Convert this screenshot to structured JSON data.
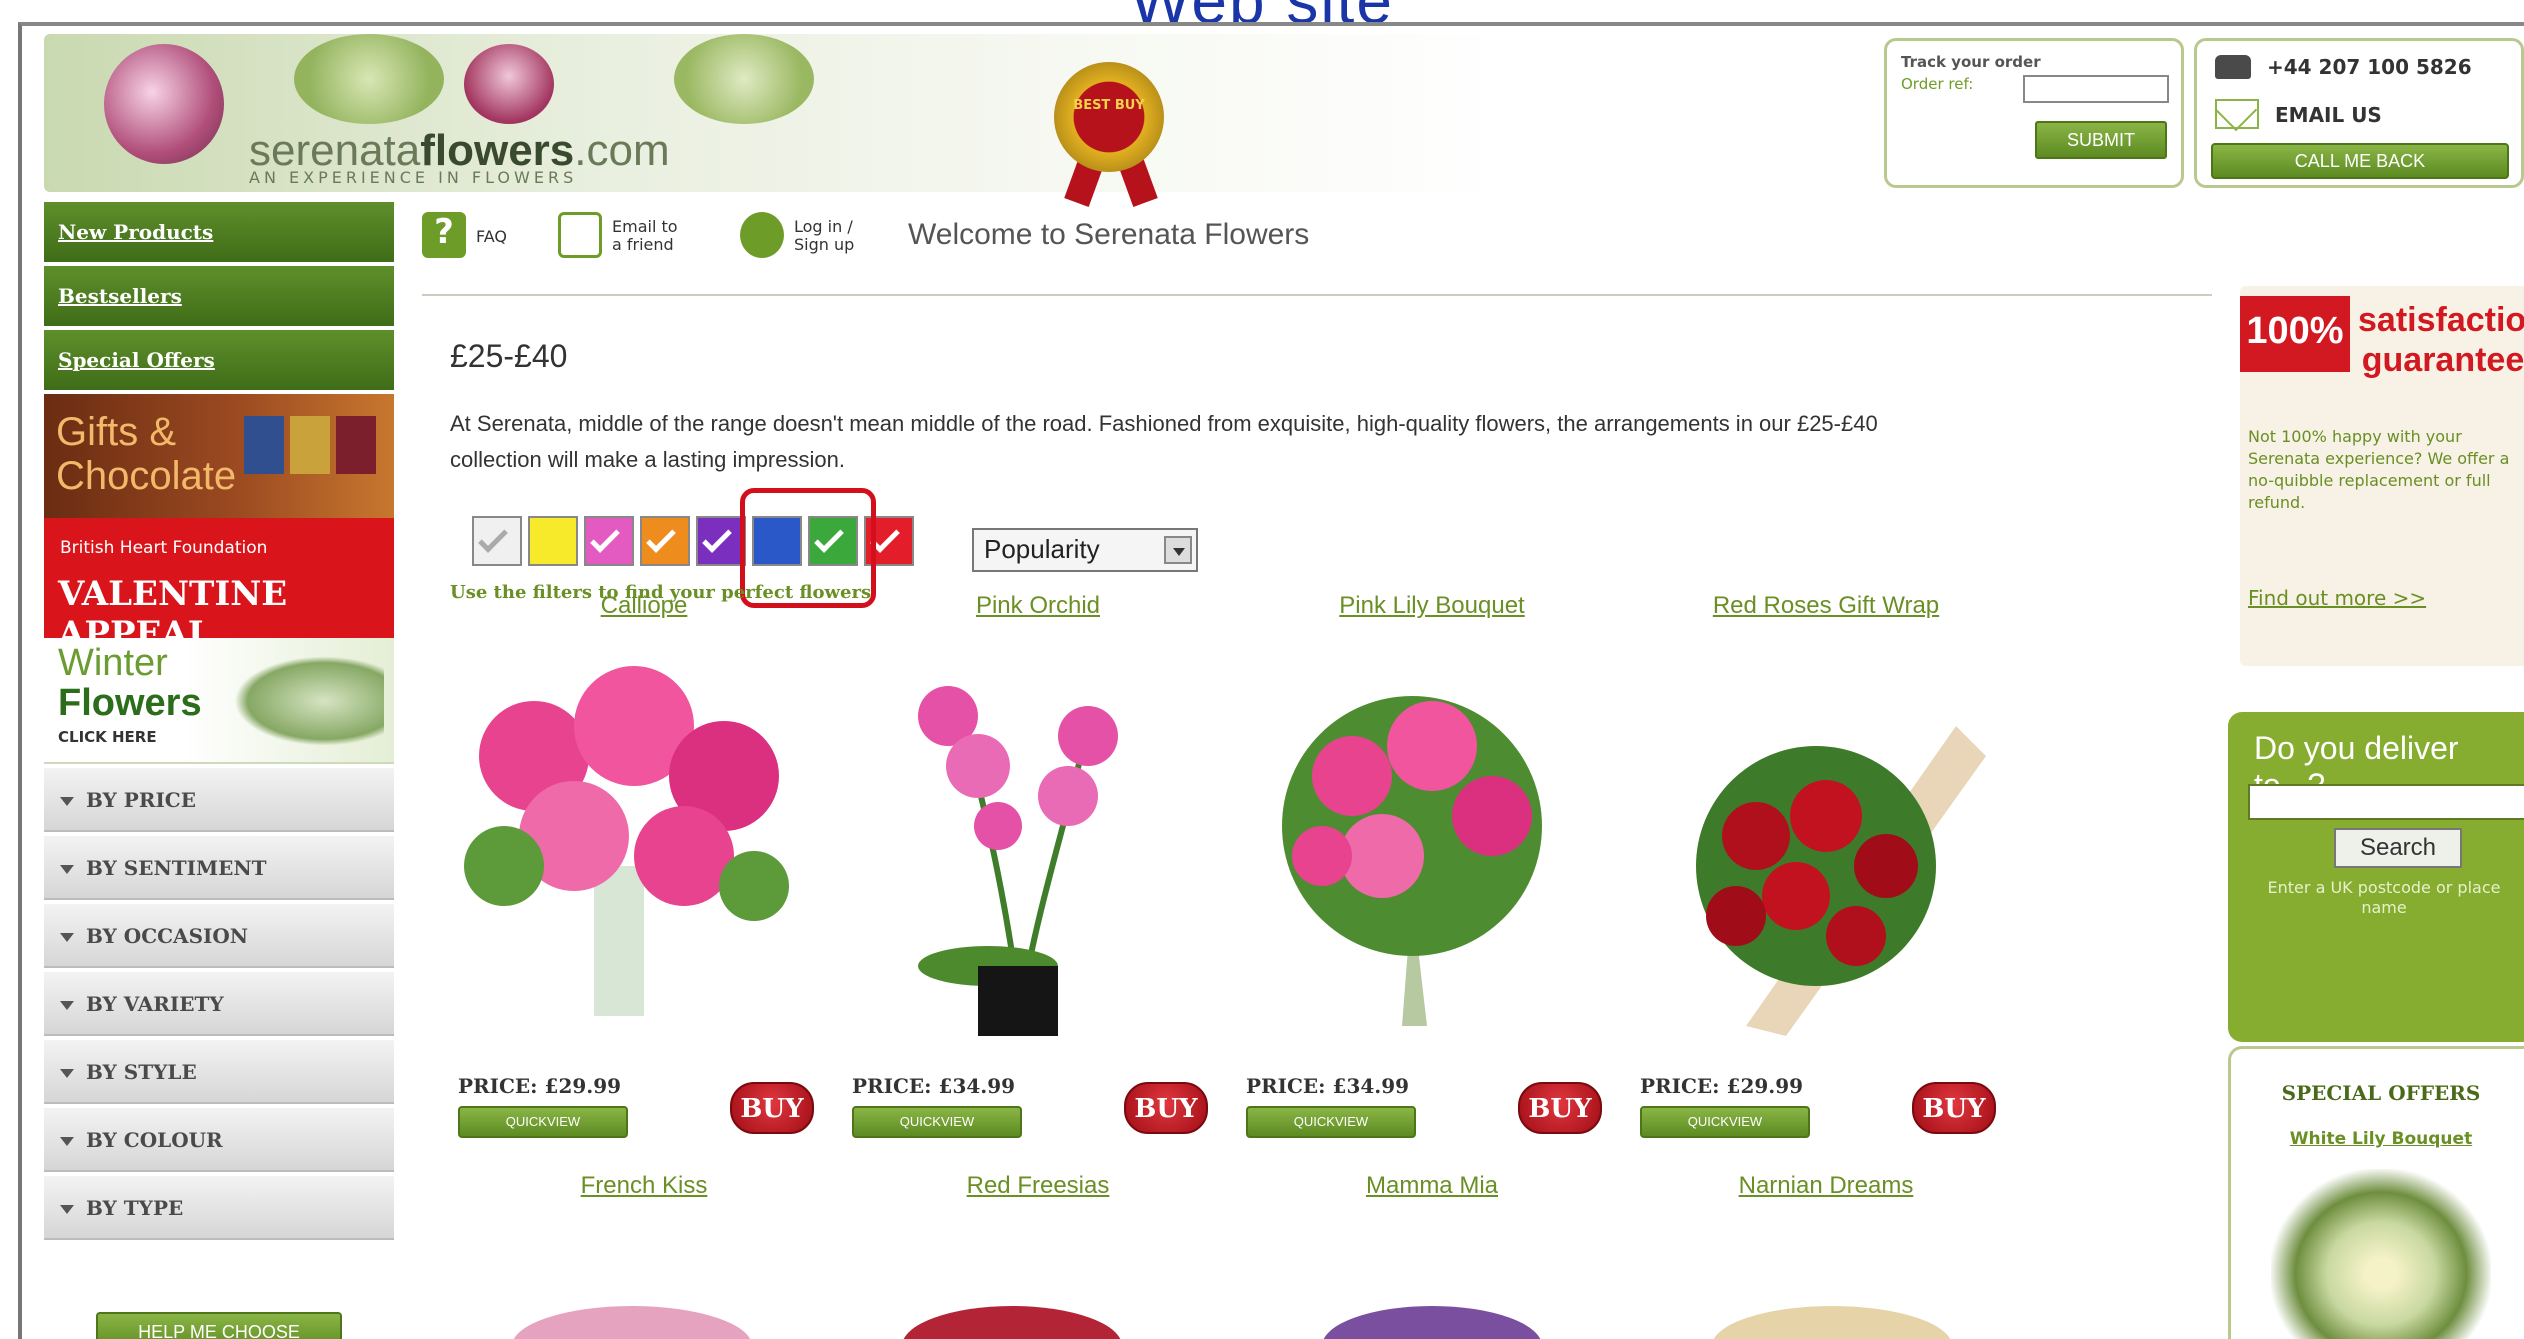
{
  "caption": "Web site",
  "header": {
    "logo_main": "serenata",
    "logo_bold": "flowers",
    "logo_tld": ".com",
    "logo_tagline": "AN EXPERIENCE IN FLOWERS",
    "award_text": "BEST BUY",
    "track_title": "Track your order",
    "order_ref_label": "Order ref:",
    "order_ref_value": "",
    "submit_label": "SUBMIT",
    "phone": "+44 207 100 5826",
    "email_label": "EMAIL US",
    "call_back_label": "CALL ME BACK"
  },
  "sidebar": {
    "nav": [
      "New Products",
      "Bestsellers",
      "Special Offers"
    ],
    "gifts_promo": "Gifts & Chocolate",
    "bhf_promo_top": "British Heart Foundation",
    "bhf_promo_main": "VALENTINE APPEAL",
    "winter_line1": "Winter",
    "winter_line2": "Flowers",
    "winter_cta": "CLICK HERE",
    "categories": [
      "BY PRICE",
      "BY SENTIMENT",
      "BY OCCASION",
      "BY VARIETY",
      "BY STYLE",
      "BY COLOUR",
      "BY TYPE"
    ],
    "help_label": "HELP ME CHOOSE"
  },
  "toolbar": {
    "faq": "FAQ",
    "email_friend_1": "Email to",
    "email_friend_2": "a friend",
    "login_1": "Log in /",
    "login_2": "Sign up",
    "welcome": "Welcome to Serenata Flowers"
  },
  "main": {
    "title": "£25-£40",
    "intro": "At Serenata, middle of the range doesn't mean middle of the road. Fashioned from exquisite, high-quality flowers, the arrangements in our £25-£40 collection will make a lasting impression.",
    "sort_selected": "Popularity",
    "filter_hint": "Use the filters to find your perfect flowers",
    "swatch_colors": [
      "#f0f0f0",
      "#f6ea2a",
      "#e35ac0",
      "#ef8c1e",
      "#7b2fbf",
      "#2a58c9",
      "#3aa83a",
      "#e41d2a"
    ],
    "products_row1": [
      {
        "name": "Calliope",
        "price": "PRICE: £29.99"
      },
      {
        "name": "Pink Orchid",
        "price": "PRICE: £34.99"
      },
      {
        "name": "Pink Lily Bouquet",
        "price": "PRICE: £34.99"
      },
      {
        "name": "Red Roses Gift Wrap",
        "price": "PRICE: £29.99"
      }
    ],
    "products_row2": [
      {
        "name": "French Kiss"
      },
      {
        "name": "Red Freesias"
      },
      {
        "name": "Mamma Mia"
      },
      {
        "name": "Narnian Dreams"
      }
    ],
    "quickview_label": "QUICKVIEW",
    "buy_label": "BUY"
  },
  "right": {
    "guarantee_pct": "100%",
    "guarantee_text": "satisfaction guarantee",
    "guarantee_body": "Not 100% happy with your Serenata experience? We offer a no-quibble replacement or full refund.",
    "guarantee_link": "Find out more >>",
    "deliver_title": "Do you deliver to...?",
    "deliver_value": "",
    "search_label": "Search",
    "deliver_hint": "Enter a UK postcode or place name",
    "special_title": "SPECIAL OFFERS",
    "special_item": "White Lily Bouquet"
  }
}
